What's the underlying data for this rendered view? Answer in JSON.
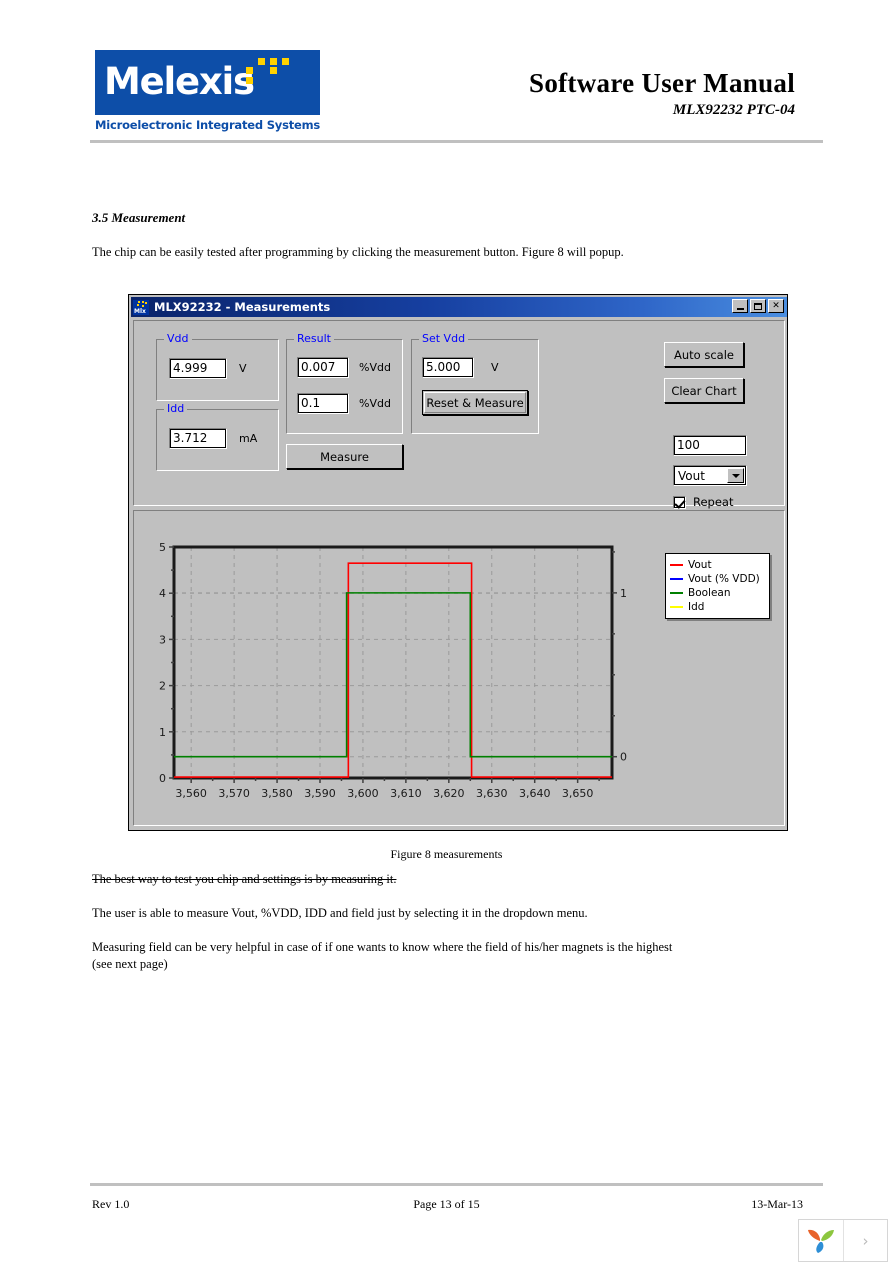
{
  "header": {
    "logo_wordmark": "Melexis",
    "logo_tagline": "Microelectronic Integrated Systems",
    "title_main": "Software User Manual",
    "title_sub": "MLX92232 PTC-04"
  },
  "document": {
    "section_heading": "3.5 Measurement",
    "intro_paragraph": "The chip can be easily tested after programming by clicking the measurement button. Figure 8 will popup.",
    "figure_caption": "Figure 8 measurements",
    "struck_paragraph": "The best way to test you chip and settings is by measuring it.",
    "para_dropdown": "The user is able to measure Vout, %VDD, IDD and field just by selecting it in the dropdown menu.",
    "para_field": "Measuring field can be very helpful in case of if one wants to know where the field of his/her magnets is the highest (see next page)"
  },
  "footer": {
    "revision": "Rev 1.0",
    "page": "Page 13 of 15",
    "date": "13-Mar-13"
  },
  "nav_widget": {
    "logo_icon": "pinwheel-logo-icon",
    "next_icon": "chevron-right-icon",
    "next_glyph": "›"
  },
  "dialog": {
    "icon": "mlx-app-icon",
    "title": "MLX92232 - Measurements",
    "window_buttons": {
      "minimize": "minimize-icon",
      "maximize": "maximize-icon",
      "close_glyph": "✕"
    },
    "groups": {
      "vdd": {
        "label": "Vdd",
        "value": "4.999",
        "unit": "V"
      },
      "idd": {
        "label": "Idd",
        "value": "3.712",
        "unit": "mA"
      },
      "result": {
        "label": "Result",
        "value_1": "0.007",
        "unit_1": "%Vdd",
        "value_2": "0.1",
        "unit_2": "%Vdd"
      },
      "set_vdd": {
        "label": "Set Vdd",
        "value": "5.000",
        "unit": "V",
        "reset_measure_label": "Reset & Measure"
      }
    },
    "measure_button": "Measure",
    "auto_scale_button": "Auto scale",
    "clear_chart_button": "Clear Chart",
    "sample_count": "100",
    "signal_select": {
      "value": "Vout",
      "arrow_icon": "chevron-down-icon"
    },
    "repeat_checkbox": {
      "label": "Repeat",
      "checked": true
    }
  },
  "colors": {
    "brand_blue": "#0d4ea8",
    "brand_yellow": "#ffd200",
    "group_label_blue": "#0000ff",
    "titlebar_dark": "#0a246a",
    "titlebar_light": "#4a8ee0",
    "dialog_face": "#c0c0c0",
    "series_vout": "#ff0000",
    "series_vout_pct": "#0000ff",
    "series_boolean": "#008000",
    "series_idd": "#ffff00"
  },
  "chart_data": {
    "type": "line",
    "title": "",
    "xlabel": "",
    "ylabel": "",
    "xlim": [
      3556,
      3658
    ],
    "ylim": [
      0,
      5
    ],
    "y2lim": [
      -0.13,
      1.28
    ],
    "xticks": [
      3560,
      3570,
      3580,
      3590,
      3600,
      3610,
      3620,
      3630,
      3640,
      3650
    ],
    "xticklabels": [
      "3,560",
      "3,570",
      "3,580",
      "3,590",
      "3,600",
      "3,610",
      "3,620",
      "3,630",
      "3,640",
      "3,650"
    ],
    "yticks": [
      0,
      1,
      2,
      3,
      4,
      5
    ],
    "yticklabels": [
      "0",
      "1",
      "2",
      "3",
      "4",
      "5"
    ],
    "y2ticks": [
      0,
      1
    ],
    "y2ticklabels": [
      "0",
      "1"
    ],
    "grid": true,
    "grid_style": "dashed",
    "legend_position": "upper-right-outside",
    "legend": [
      "Vout",
      "Vout (% VDD)",
      "Boolean",
      "Idd"
    ],
    "series": [
      {
        "name": "Vout",
        "color": "#ff0000",
        "axis": "left",
        "x": [
          3556,
          3596.6,
          3596.6,
          3625.3,
          3625.3,
          3658
        ],
        "values": [
          0.02,
          0.02,
          4.65,
          4.65,
          0.02,
          0.02
        ]
      },
      {
        "name": "Vout (% VDD)",
        "color": "#0000ff",
        "axis": "left",
        "x": [],
        "values": []
      },
      {
        "name": "Boolean",
        "color": "#008000",
        "axis": "right",
        "x": [
          3556,
          3596.2,
          3596.2,
          3625.0,
          3625.0,
          3658
        ],
        "values": [
          0,
          0,
          1,
          1,
          0,
          0
        ]
      },
      {
        "name": "Idd",
        "color": "#ffff00",
        "axis": "left",
        "x": [],
        "values": []
      }
    ]
  }
}
